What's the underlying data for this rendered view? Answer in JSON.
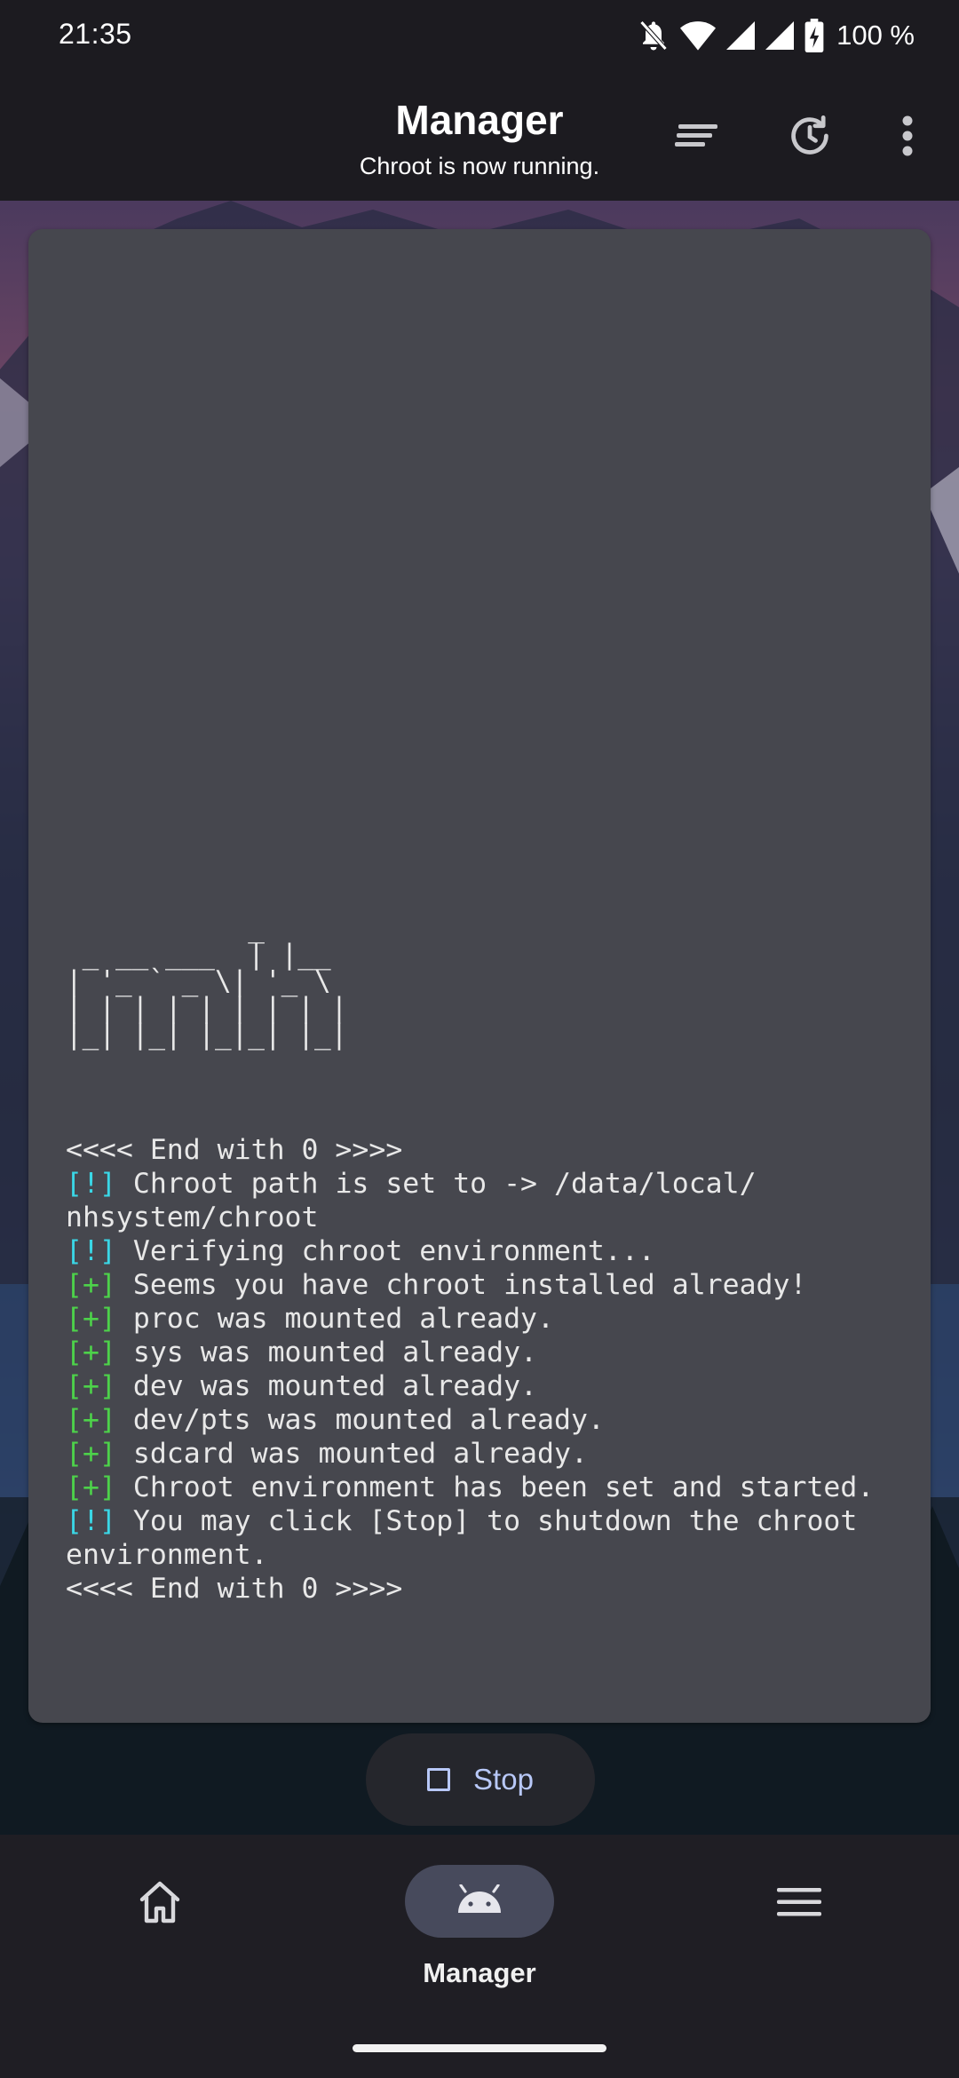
{
  "status_bar": {
    "time": "21:35",
    "battery": "100 %",
    "icons": [
      "bell-off-icon",
      "wifi-icon",
      "signal-icon",
      "signal-icon",
      "battery-charging-icon"
    ]
  },
  "app_bar": {
    "title": "Manager",
    "subtitle": "Chroot is now running.",
    "actions": [
      "sort-lines-icon",
      "history-icon",
      "more-vert-icon"
    ]
  },
  "terminal": {
    "ascii_logo": "           _\n _ __ ___  | |__\n| '_ ` _ \\| '_ \\\n| | | | | | | | |\n|_| |_| |_|_| |_|",
    "lines": [
      {
        "tag": "",
        "text": "<<<< End with 0 >>>>"
      },
      {
        "tag": "[!]",
        "text": " Chroot path is set to -> /data/local/"
      },
      {
        "tag": "",
        "text": "nhsystem/chroot"
      },
      {
        "tag": "[!]",
        "text": " Verifying chroot environment..."
      },
      {
        "tag": "[+]",
        "text": " Seems you have chroot installed already!"
      },
      {
        "tag": "[+]",
        "text": " proc was mounted already."
      },
      {
        "tag": "[+]",
        "text": " sys was mounted already."
      },
      {
        "tag": "[+]",
        "text": " dev was mounted already."
      },
      {
        "tag": "[+]",
        "text": " dev/pts was mounted already."
      },
      {
        "tag": "[+]",
        "text": " sdcard was mounted already."
      },
      {
        "tag": "[+]",
        "text": " Chroot environment has been set and started."
      },
      {
        "tag": "[!]",
        "text": " You may click [Stop] to shutdown the chroot"
      },
      {
        "tag": "",
        "text": "environment."
      },
      {
        "tag": "",
        "text": "<<<< End with 0 >>>>"
      }
    ],
    "colors": {
      "info": "#3ad7e6",
      "ok": "#4dd24a",
      "text": "#e8e8e8",
      "bg": "#46474e"
    }
  },
  "stop_button": {
    "label": "Stop",
    "icon": "stop-square-icon"
  },
  "bottom_nav": {
    "items": [
      {
        "label": "",
        "icon": "home-icon",
        "selected": false
      },
      {
        "label": "Manager",
        "icon": "android-icon",
        "selected": true
      },
      {
        "label": "",
        "icon": "menu-icon",
        "selected": false
      }
    ]
  }
}
